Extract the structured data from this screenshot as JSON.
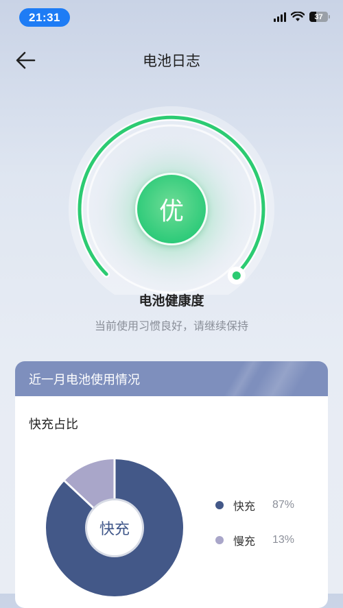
{
  "status_bar": {
    "time": "21:31",
    "battery_level": "37",
    "battery_fraction": 0.37,
    "icons": [
      "cellular-signal-icon",
      "wifi-icon",
      "battery-icon"
    ]
  },
  "nav": {
    "back_icon": "arrow-left-icon",
    "title": "电池日志"
  },
  "health": {
    "grade": "优",
    "label": "电池健康度",
    "subtitle": "当前使用习惯良好，请继续保持",
    "accent_color": "#2ccb72"
  },
  "usage_card": {
    "header": "近一月电池使用情况",
    "header_color": "#7e8fbd",
    "section_title": "快充占比",
    "donut_center": "快充",
    "items": [
      {
        "name": "快充",
        "value": "87%",
        "fraction": 0.87,
        "color": "#435888"
      },
      {
        "name": "慢充",
        "value": "13%",
        "fraction": 0.13,
        "color": "#a9a6c9"
      }
    ]
  }
}
